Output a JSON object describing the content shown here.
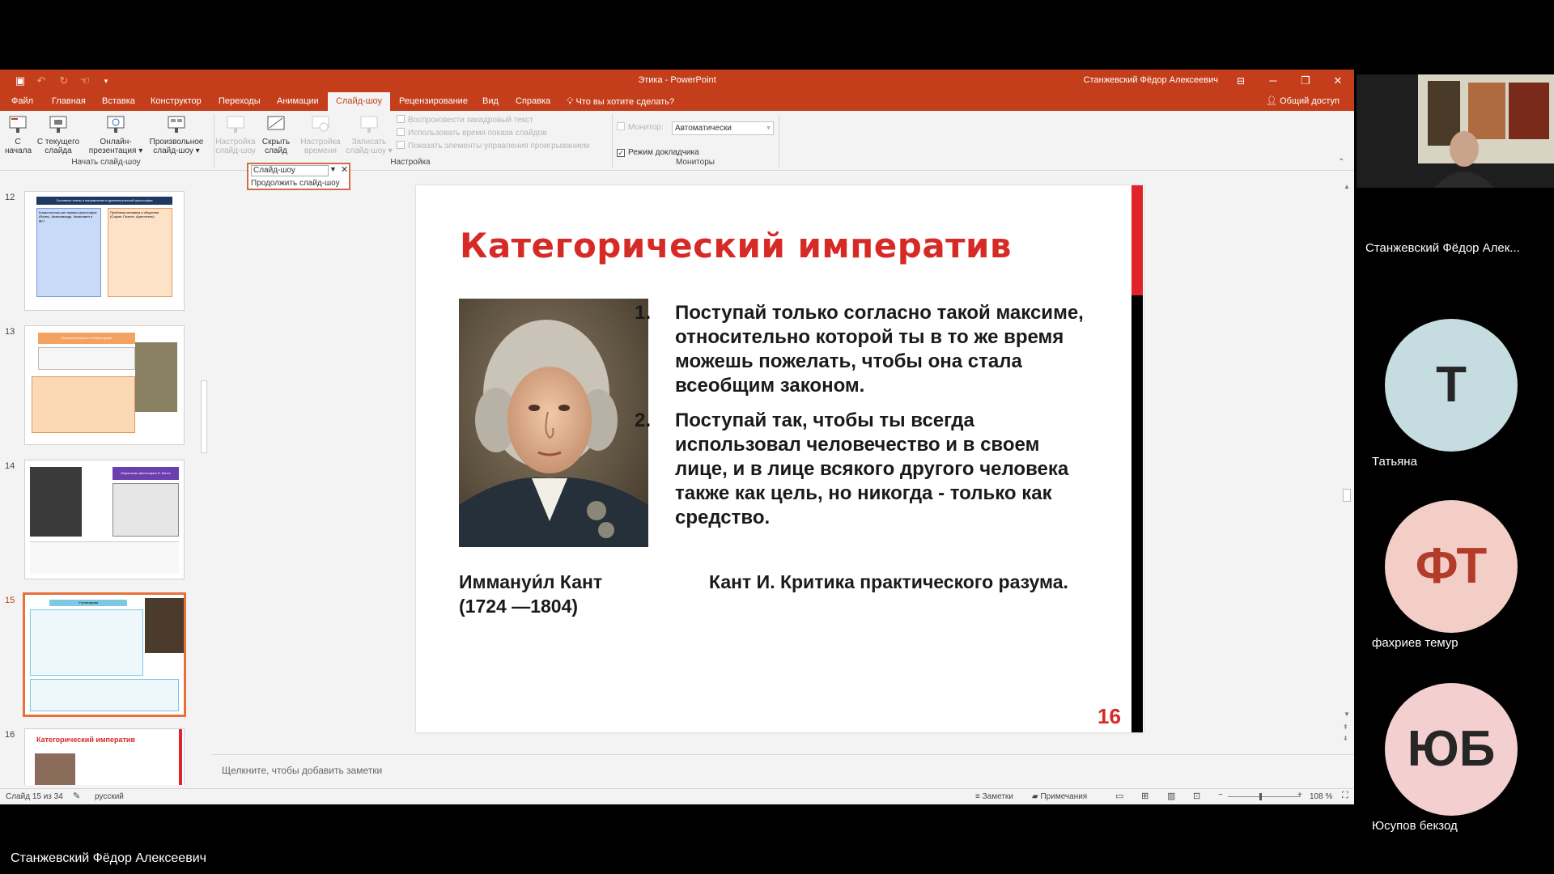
{
  "window": {
    "app_title": "Этика - PowerPoint",
    "user_name": "Станжевский Фёдор Алексеевич",
    "controls": {
      "minimize": "─",
      "restore": "❐",
      "close": "✕"
    }
  },
  "menu": {
    "tabs": [
      "Файл",
      "Главная",
      "Вставка",
      "Конструктор",
      "Переходы",
      "Анимации",
      "Слайд-шоу",
      "Рецензирование",
      "Вид",
      "Справка"
    ],
    "active_tab": "Слайд-шоу",
    "tell_me": "Что вы хотите сделать?",
    "share": "Общий доступ"
  },
  "ribbon": {
    "start_group": {
      "label": "Начать слайд-шоу",
      "from_start": [
        "С",
        "начала"
      ],
      "from_current": [
        "С текущего",
        "слайда"
      ],
      "online": [
        "Онлайн-",
        "презентация ▾"
      ],
      "custom": [
        "Произвольное",
        "слайд-шоу ▾"
      ]
    },
    "setup_group": {
      "label": "Настройка",
      "setup": [
        "Настройка",
        "слайд-шоу"
      ],
      "hide": [
        "Скрыть",
        "слайд"
      ],
      "rehearse": [
        "Настройка",
        "времени"
      ],
      "record": [
        "Записать",
        "слайд-шоу ▾"
      ],
      "play_narrations": "Воспроизвести закадровый текст",
      "use_timings": "Использовать время показа слайдов",
      "show_media_controls": "Показать элементы управления проигрыванием"
    },
    "monitors_group": {
      "label": "Мониторы",
      "monitor_label": "Монитор:",
      "monitor_value": "Автоматически",
      "presenter_view": "Режим докладчика"
    }
  },
  "popup": {
    "title": "Слайд-шоу",
    "item": "Продолжить слайд-шоу"
  },
  "thumbnails": {
    "numbers": [
      "12",
      "13",
      "14",
      "15",
      "16"
    ],
    "selected": "15",
    "slide12": {
      "header": "Основные этапы и направления в древнегреческой философии",
      "col_left": [
        "Космологичес-кие первых философов",
        "(Фалес, Анаксимандр, Анаксимен и др.)"
      ],
      "col_right": [
        "Проблема человека и общества",
        "(Сократ, Платон, Аристотель)"
      ]
    },
    "slide13_header": "Моральная мысль в Новое время",
    "slide14_header": "Моральная философия И. Канта",
    "slide15_header": "Утилитаризм",
    "slide16_header": "Категорический императив"
  },
  "slide": {
    "title": "Категорический императив",
    "rules": [
      {
        "num": "1.",
        "text": "Поступай только согласно такой максиме, относительно которой ты в то же время можешь пожелать, чтобы она стала всеобщим законом."
      },
      {
        "num": "2.",
        "text": "Поступай так, чтобы ты всегда использовал человечество и в своем лице, и в лице всякого другого человека также как цель, но никогда - только как средство."
      }
    ],
    "author_name": "Иммануи́л Кант",
    "author_years": "(1724 —1804)",
    "source": "Кант И. Критика практического разума.",
    "page_number": "16",
    "colors": {
      "title": "#d62a26",
      "bar_red": "#e0242a",
      "bar_black": "#000000"
    }
  },
  "notes_placeholder": "Щелкните, чтобы добавить заметки",
  "status": {
    "slide_counter": "Слайд 15 из 34",
    "language": "русский",
    "notes_btn": "Заметки",
    "comments_btn": "Примечания",
    "zoom": "108 %"
  },
  "participants": [
    {
      "name": "Станжевский Фёдор Алек...",
      "type": "video"
    },
    {
      "name": "Татьяна",
      "initials": "Т",
      "color": "#c5dde0"
    },
    {
      "name": "фахриев темур",
      "initials": "ФТ",
      "color": "#f3cec6",
      "initials_color": "#b33b2a"
    },
    {
      "name": "Юсупов бекзод",
      "initials": "ЮБ",
      "color": "#f3cfcf"
    }
  ],
  "presenter_label": "Станжевский Фёдор Алексеевич"
}
